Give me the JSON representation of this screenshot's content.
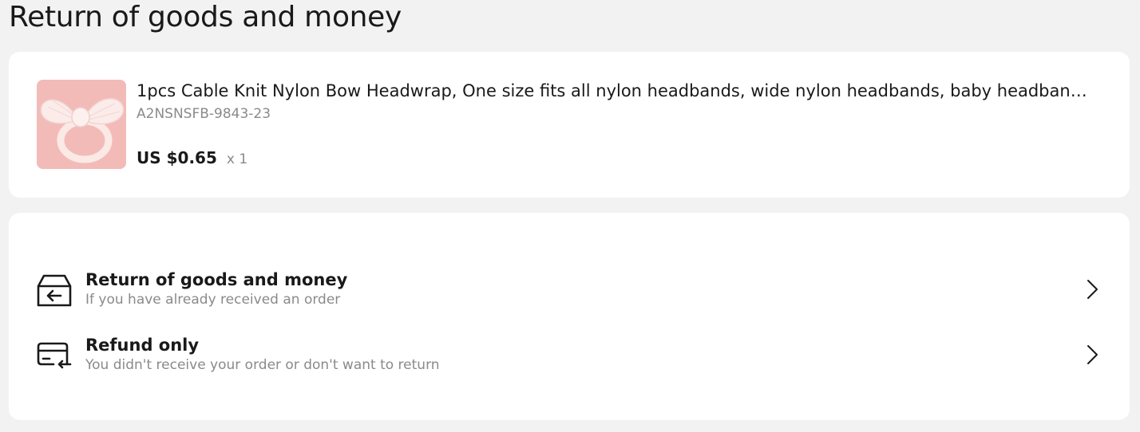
{
  "page": {
    "title": "Return of goods and money"
  },
  "product": {
    "name": "1pcs Cable Knit Nylon Bow Headwrap, One size fits all nylon headbands, wide nylon headbands, baby headbands, Knot b...",
    "sku": "A2NSNSFB-9843-23",
    "price": "US $0.65",
    "quantity": "x 1",
    "image_icon": "pink-bow-headband-photo"
  },
  "options": [
    {
      "title": "Return of goods and money",
      "subtitle": "If you have already received an order",
      "icon": "return-box-icon"
    },
    {
      "title": "Refund only",
      "subtitle": "You didn't receive your order or don't want to return",
      "icon": "card-refund-icon"
    }
  ],
  "colors": {
    "background": "#f2f2f2",
    "card": "#ffffff",
    "text_primary": "#191919",
    "text_secondary": "#8a8a8a",
    "image_background": "#f2b9b6"
  }
}
